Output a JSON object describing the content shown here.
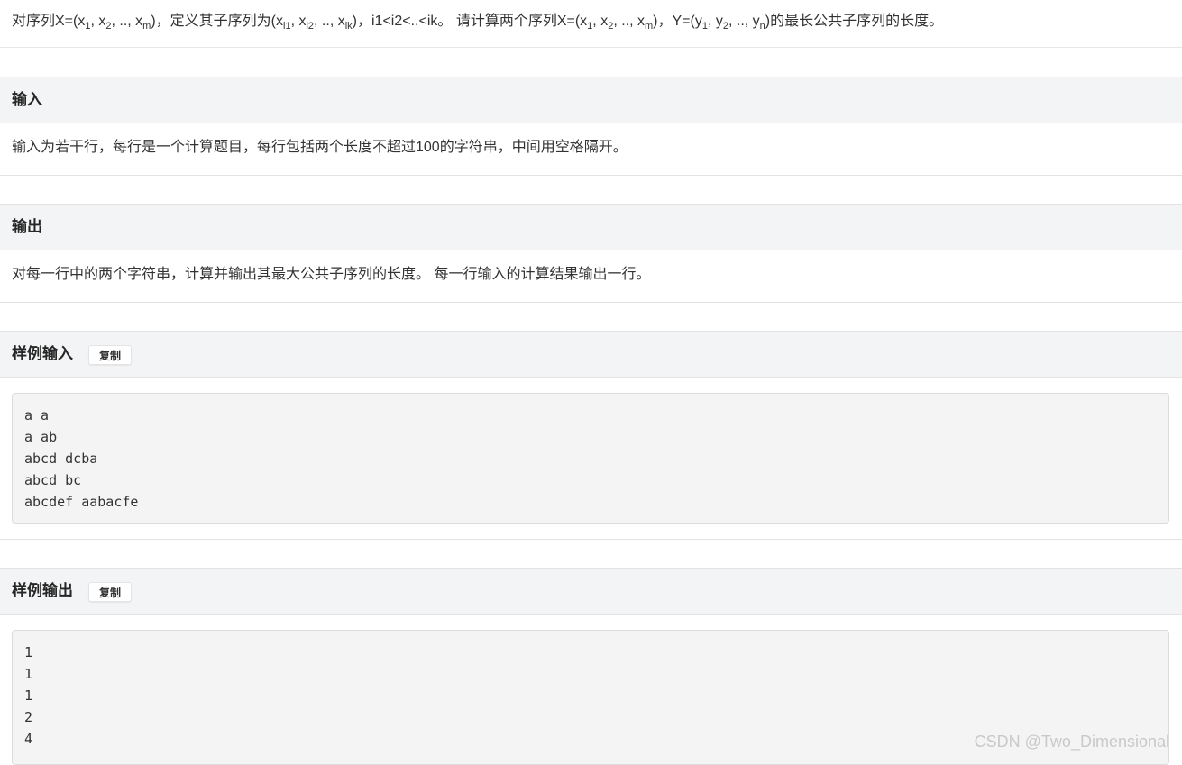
{
  "description": {
    "p1": "对序列X=(x",
    "s1": "1",
    "p2": ", x",
    "s2": "2",
    "p3": ", .., x",
    "s3": "m",
    "p4": ")，定义其子序列为(x",
    "s4": "i1",
    "p5": ", x",
    "s5": "i2",
    "p6": ", .., x",
    "s6": "ik",
    "p7": ")，i1<i2<..<ik。 请计算两个序列X=(x",
    "s7": "1",
    "p8": ", x",
    "s8": "2",
    "p9": ", .., x",
    "s9": "m",
    "p10": ")，Y=(y",
    "s10": "1",
    "p11": ", y",
    "s11": "2",
    "p12": ", .., y",
    "s12": "n",
    "p13": ")的最长公共子序列的长度。"
  },
  "input_section": {
    "title": "输入",
    "text": "输入为若干行，每行是一个计算题目，每行包括两个长度不超过100的字符串，中间用空格隔开。"
  },
  "output_section": {
    "title": "输出",
    "text": "对每一行中的两个字符串，计算并输出其最大公共子序列的长度。 每一行输入的计算结果输出一行。"
  },
  "sample_input": {
    "title": "样例输入",
    "copy_label": "复制",
    "lines": [
      "a a",
      "a ab",
      "abcd dcba",
      "abcd bc",
      "abcdef aabacfe"
    ]
  },
  "sample_output": {
    "title": "样例输出",
    "copy_label": "复制",
    "lines": [
      "1",
      "1",
      "1",
      "2",
      "4"
    ]
  },
  "watermark": "CSDN @Two_Dimensional"
}
